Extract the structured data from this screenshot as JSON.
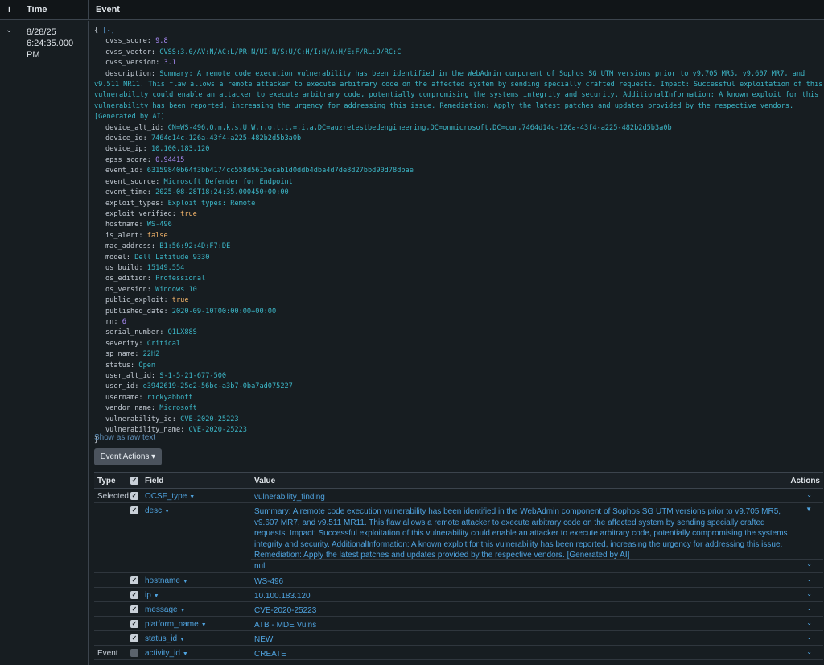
{
  "header": {
    "info_icon": "i",
    "time": "Time",
    "event": "Event"
  },
  "row": {
    "date": "8/28/25",
    "time": "6:24:35.000 PM"
  },
  "json_open": "{",
  "json_collapse": "[-]",
  "json_close": "}",
  "fields": [
    {
      "key": "cvss_score",
      "value": "9.8",
      "type": "n"
    },
    {
      "key": "cvss_vector",
      "value": "CVSS:3.0/AV:N/AC:L/PR:N/UI:N/S:U/C:H/I:H/A:H/E:F/RL:O/RC:C",
      "type": "s"
    },
    {
      "key": "cvss_version",
      "value": "3.1",
      "type": "n"
    },
    {
      "key": "description",
      "value": "Summary: A remote code execution vulnerability has been identified in the WebAdmin component of Sophos SG UTM versions prior to v9.705 MR5, v9.607 MR7, and v9.511 MR11. This flaw allows a remote attacker to execute arbitrary code on the affected system by sending specially crafted requests. Impact: Successful exploitation of this vulnerability could enable an attacker to execute arbitrary code, potentially compromising the systems integrity and security. AdditionalInformation: A known exploit for this vulnerability has been reported, increasing the urgency for addressing this issue. Remediation: Apply the latest patches and updates provided by the respective vendors. [Generated by AI]",
      "type": "s"
    },
    {
      "key": "device_alt_id",
      "value": "CN=WS-496,O,n,k,s,U,W,r,o,t,t,=,i,a,DC=auzretestbedengineering,DC=onmicrosoft,DC=com,7464d14c-126a-43f4-a225-482b2d5b3a0b",
      "type": "s"
    },
    {
      "key": "device_id",
      "value": "7464d14c-126a-43f4-a225-482b2d5b3a0b",
      "type": "s"
    },
    {
      "key": "device_ip",
      "value": "10.100.183.120",
      "type": "s"
    },
    {
      "key": "epss_score",
      "value": "0.94415",
      "type": "n"
    },
    {
      "key": "event_id",
      "value": "63159840b64f3bb4174cc558d5615ecab1d0ddb4dba4d7de8d27bbd90d78dbae",
      "type": "s"
    },
    {
      "key": "event_source",
      "value": "Microsoft Defender for Endpoint",
      "type": "s"
    },
    {
      "key": "event_time",
      "value": "2025-08-28T18:24:35.000450+00:00",
      "type": "s"
    },
    {
      "key": "exploit_types",
      "value": "Exploit types: Remote",
      "type": "s"
    },
    {
      "key": "exploit_verified",
      "value": "true",
      "type": "b"
    },
    {
      "key": "hostname",
      "value": "WS-496",
      "type": "s"
    },
    {
      "key": "is_alert",
      "value": "false",
      "type": "b"
    },
    {
      "key": "mac_address",
      "value": "B1:56:92:4D:F7:DE",
      "type": "s"
    },
    {
      "key": "model",
      "value": "Dell Latitude 9330",
      "type": "s"
    },
    {
      "key": "os_build",
      "value": "15149.554",
      "type": "s"
    },
    {
      "key": "os_edition",
      "value": "Professional",
      "type": "s"
    },
    {
      "key": "os_version",
      "value": "Windows 10",
      "type": "s"
    },
    {
      "key": "public_exploit",
      "value": "true",
      "type": "b"
    },
    {
      "key": "published_date",
      "value": "2020-09-10T00:00:00+00:00",
      "type": "s"
    },
    {
      "key": "rn",
      "value": "6",
      "type": "n"
    },
    {
      "key": "serial_number",
      "value": "Q1LX88S",
      "type": "s"
    },
    {
      "key": "severity",
      "value": "Critical",
      "type": "s"
    },
    {
      "key": "sp_name",
      "value": "22H2",
      "type": "s"
    },
    {
      "key": "status",
      "value": "Open",
      "type": "s"
    },
    {
      "key": "user_alt_id",
      "value": "S-1-5-21-677-500",
      "type": "s"
    },
    {
      "key": "user_id",
      "value": "e3942619-25d2-56bc-a3b7-0ba7ad075227",
      "type": "s"
    },
    {
      "key": "username",
      "value": "rickyabbott",
      "type": "s"
    },
    {
      "key": "vendor_name",
      "value": "Microsoft",
      "type": "s"
    },
    {
      "key": "vulnerability_id",
      "value": "CVE-2020-25223",
      "type": "s"
    },
    {
      "key": "vulnerability_name",
      "value": "CVE-2020-25223",
      "type": "s"
    }
  ],
  "raw_link": "Show as raw text",
  "event_actions": "Event Actions",
  "table": {
    "headers": {
      "type": "Type",
      "field": "Field",
      "value": "Value",
      "actions": "Actions"
    },
    "rows": [
      {
        "type": "Selected",
        "checked": true,
        "field": "OCSF_type",
        "value": "vulnerability_finding"
      },
      {
        "type": "",
        "checked": true,
        "field": "desc",
        "value": "Summary: A remote code execution vulnerability has been identified in the WebAdmin component of Sophos SG UTM versions prior to v9.705 MR5, v9.607 MR7, and v9.511 MR11. This flaw allows a remote attacker to execute arbitrary code on the affected system by sending specially crafted requests. Impact: Successful exploitation of this vulnerability could enable an attacker to execute arbitrary code, potentially compromising the systems integrity and security. AdditionalInformation: A known exploit for this vulnerability has been reported, increasing the urgency for addressing this issue. Remediation: Apply the latest patches and updates provided by the respective vendors. [Generated by AI]",
        "value2": "null"
      },
      {
        "type": "",
        "checked": true,
        "field": "hostname",
        "value": "WS-496"
      },
      {
        "type": "",
        "checked": true,
        "field": "ip",
        "value": "10.100.183.120"
      },
      {
        "type": "",
        "checked": true,
        "field": "message",
        "value": "CVE-2020-25223"
      },
      {
        "type": "",
        "checked": true,
        "field": "platform_name",
        "value": "ATB - MDE Vulns"
      },
      {
        "type": "",
        "checked": true,
        "field": "status_id",
        "value": "NEW"
      },
      {
        "type": "Event",
        "checked": false,
        "field": "activity_id",
        "value": "CREATE"
      }
    ]
  }
}
